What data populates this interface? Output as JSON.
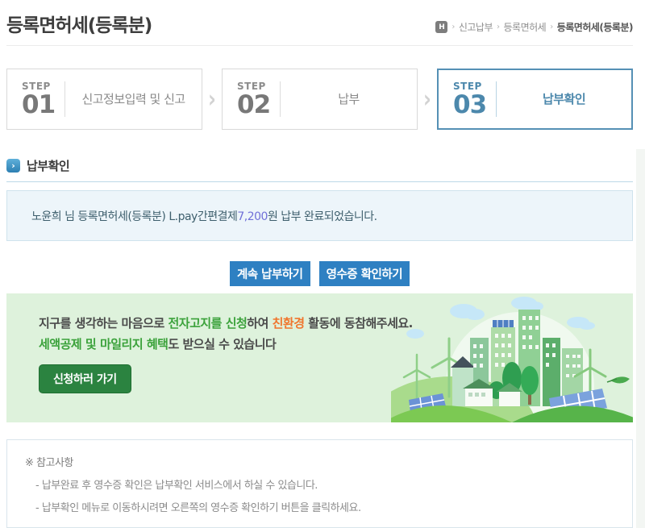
{
  "header": {
    "title": "등록면허세(등록분)",
    "breadcrumb": {
      "home_label": "H",
      "separator": "›",
      "item1": "신고납부",
      "item2": "등록면허세",
      "current": "등록면허세(등록분)"
    }
  },
  "steps": {
    "arrow": "›",
    "items": [
      {
        "label": "STEP",
        "number": "01",
        "title": "신고정보입력 및 신고"
      },
      {
        "label": "STEP",
        "number": "02",
        "title": "납부"
      },
      {
        "label": "STEP",
        "number": "03",
        "title": "납부확인"
      }
    ]
  },
  "section": {
    "icon": "›",
    "title": "납부확인"
  },
  "message": {
    "prefix": "노윤희 님 등록면허세(등록분) L.pay간편결제",
    "amount": "7,200",
    "suffix": "원 납부 완료되었습니다."
  },
  "actions": {
    "continue_label": "계속 납부하기",
    "receipt_label": "영수증 확인하기"
  },
  "banner": {
    "line1_prefix": "지구를 생각하는 마음으로 ",
    "line1_green": "전자고지를 신청",
    "line1_mid": "하여 ",
    "line1_orange": "친환경",
    "line1_suffix": " 활동에 동참해주세요.",
    "line2_green": "세액공제 및 마일리지 혜택",
    "line2_suffix": "도 받으실 수 있습니다",
    "button_label": "신청하러 가기"
  },
  "notes": {
    "title": "※ 참고사항",
    "items": [
      "- 납부완료 후 영수증 확인은 납부확인 서비스에서 하실 수 있습니다.",
      "- 납부확인 메뉴로 이동하시려면 오른쪽의 영수증 확인하기 버튼을 클릭하세요."
    ]
  },
  "colors": {
    "step_active": "#4c88ac",
    "button_blue": "#2e80c2",
    "banner_bg": "#def2dc",
    "banner_green": "#3ba23b",
    "banner_orange": "#f0762e",
    "banner_button_green": "#2b8340",
    "message_bg": "#edf5fa",
    "amount_blue": "#7070d8"
  }
}
